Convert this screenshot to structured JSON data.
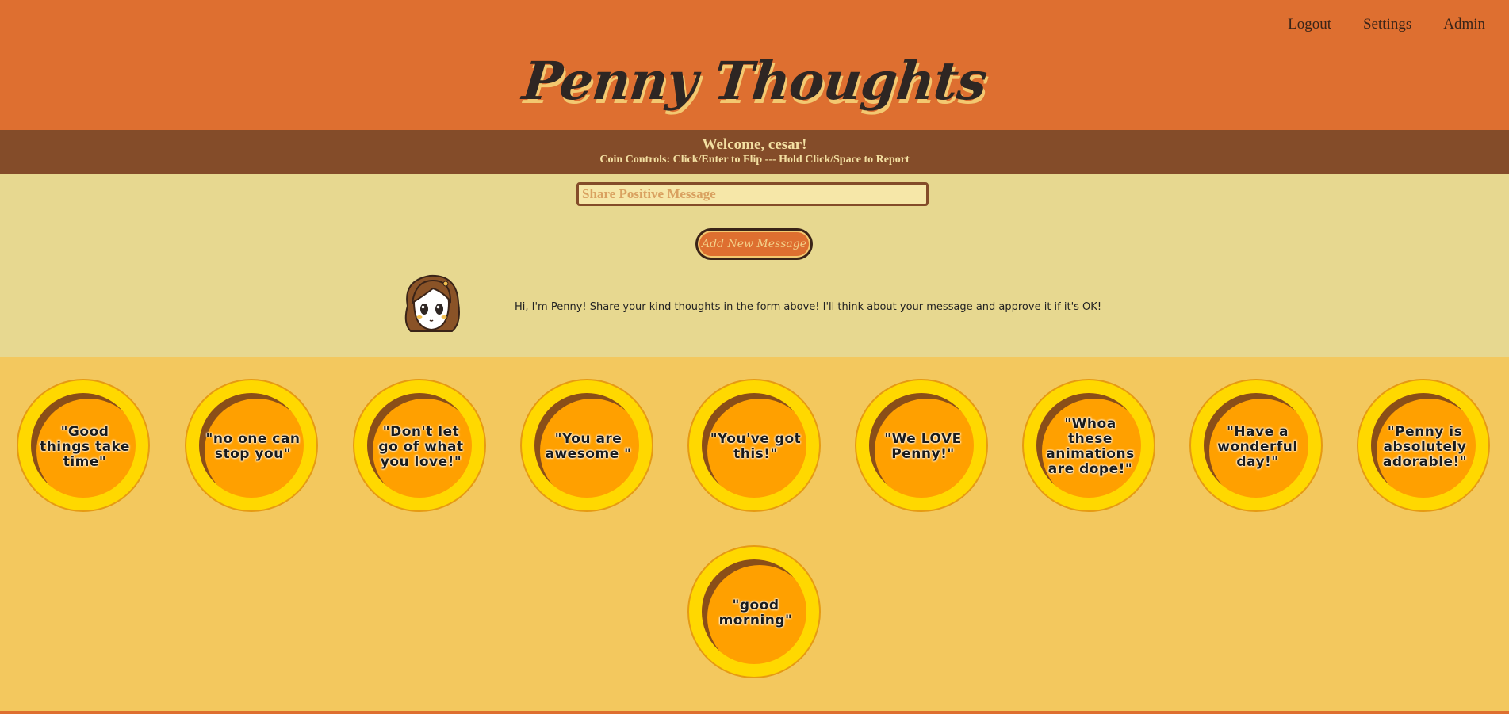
{
  "nav": {
    "logout": "Logout",
    "settings": "Settings",
    "admin": "Admin"
  },
  "header": {
    "title": "Penny Thoughts"
  },
  "welcome": {
    "greeting": "Welcome, cesar!",
    "controls": "Coin Controls: Click/Enter to Flip --- Hold Click/Space to Report"
  },
  "form": {
    "placeholder": "Share Positive Message",
    "value": "",
    "submit_label": "Add New Message"
  },
  "penny": {
    "message": "Hi, I'm Penny! Share your kind thoughts in the form above! I'll think about your message and approve it if it's OK!"
  },
  "coins": [
    "\"Good things take time\"",
    "\"no one can stop you\"",
    "\"Don't let go of what you love!\"",
    "\"You are awesome \"",
    "\"You've got this!\"",
    "\"We LOVE Penny!\"",
    "\"Whoa these animations are dope!\"",
    "\"Have a wonderful day!\"",
    "\"Penny is absolutely adorable!\"",
    "\"good morning\""
  ],
  "colors": {
    "header_bg": "#DE6F30",
    "welcome_bg": "#844C29",
    "form_bg": "#E7D890",
    "coin_area_bg": "#F3C85E",
    "coin_rim": "#FFD800",
    "coin_face": "#FFA000"
  }
}
